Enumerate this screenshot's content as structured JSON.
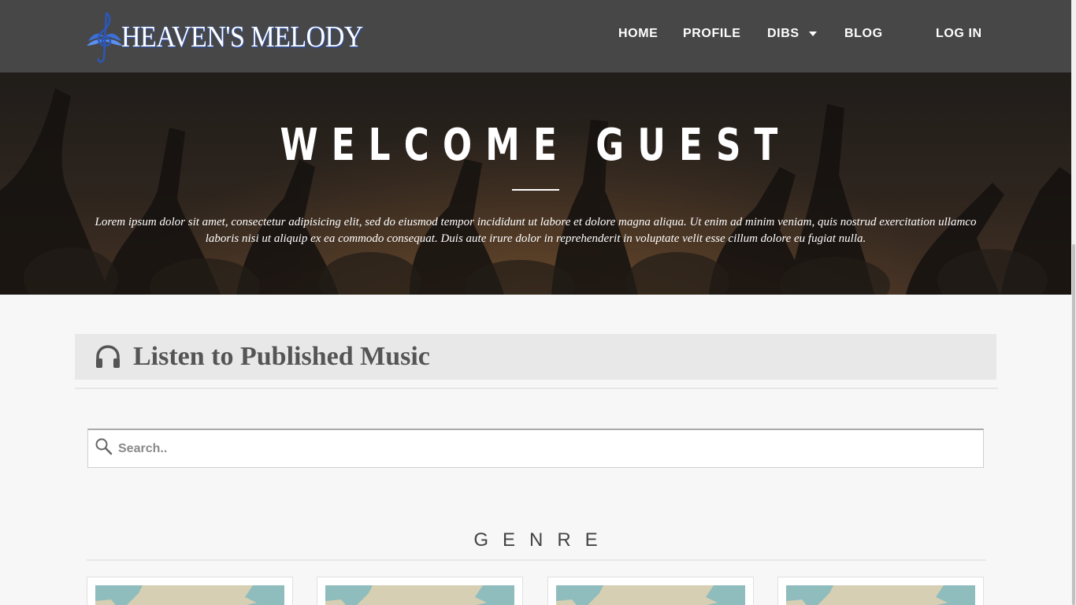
{
  "brand": {
    "name": "HEAVEN'S MELODY",
    "logo_icon": "treble-clef-wings-icon"
  },
  "nav": {
    "home": "HOME",
    "profile": "PROFILE",
    "dibs": "DIBS",
    "blog": "BLOG",
    "login": "LOG IN"
  },
  "hero": {
    "title": "WELCOME GUEST",
    "text": "Lorem ipsum dolor sit amet, consectetur adipisicing elit, sed do eiusmod tempor incididunt ut labore et dolore magna aliqua. Ut enim ad minim veniam, quis nostrud exercitation ullamco laboris nisi ut aliquip ex ea commodo consequat. Duis aute irure dolor in reprehenderit in voluptate velit esse cillum dolore eu fugiat nulla."
  },
  "section": {
    "title": "Listen to Published Music",
    "icon": "headphones-icon"
  },
  "search": {
    "placeholder": "Search..",
    "icon": "search-icon"
  },
  "genre": {
    "title": "GENRE"
  },
  "colors": {
    "navbar": "#474747",
    "page_bg": "#f7f7f7",
    "section_header_bg": "#e8e8e8",
    "heading_text": "#555555",
    "logo_accent": "#3a6fd8"
  }
}
